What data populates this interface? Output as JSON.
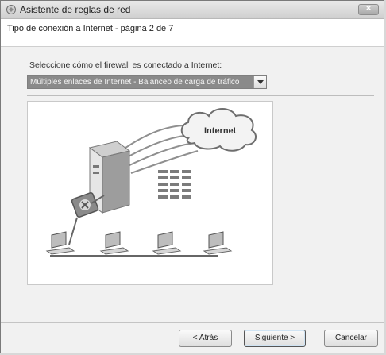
{
  "window": {
    "title": "Asistente de reglas de red"
  },
  "header": {
    "title": "Tipo de conexión a Internet - página 2 de 7"
  },
  "main": {
    "prompt": "Seleccione cómo el firewall es conectado a Internet:",
    "connection_select": {
      "value": "Múltiples enlaces de Internet - Balanceo de carga de tráfico"
    },
    "diagram": {
      "cloud_label": "Internet"
    }
  },
  "footer": {
    "back_label": "< Atrás",
    "next_label": "Siguiente >",
    "cancel_label": "Cancelar"
  },
  "icons": [
    "network-wizard-icon",
    "close-icon",
    "dropdown-arrow-icon",
    "internet-cloud-icon",
    "firewall-server-icon",
    "router-icon",
    "client-computer-icon",
    "routing-table-icon"
  ]
}
